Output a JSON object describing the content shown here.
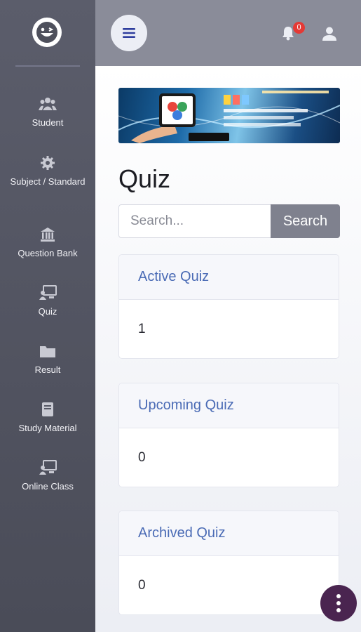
{
  "sidebar": {
    "logo_icon": "smiley-logo-icon",
    "items": [
      {
        "label": "Student",
        "icon": "users-icon"
      },
      {
        "label": "Subject / Standard",
        "icon": "gear-icon"
      },
      {
        "label": "Question Bank",
        "icon": "bank-icon"
      },
      {
        "label": "Quiz",
        "icon": "presentation-icon"
      },
      {
        "label": "Result",
        "icon": "folder-icon"
      },
      {
        "label": "Study Material",
        "icon": "book-icon"
      },
      {
        "label": "Online Class",
        "icon": "presentation-icon"
      }
    ]
  },
  "topbar": {
    "menu_icon": "hamburger-icon",
    "notification_icon": "bell-icon",
    "notification_count": "0",
    "user_icon": "user-icon"
  },
  "page": {
    "title": "Quiz",
    "search_placeholder": "Search...",
    "search_button": "Search"
  },
  "cards": [
    {
      "title": "Active Quiz",
      "value": "1"
    },
    {
      "title": "Upcoming Quiz",
      "value": "0"
    },
    {
      "title": "Archived Quiz",
      "value": "0"
    }
  ],
  "fab_icon": "more-vertical-icon",
  "colors": {
    "sidebar": "#52545f",
    "topbar": "#8a8c99",
    "accent_text": "#4a6bb5",
    "menu_icon": "#2f3e9e",
    "badge": "#e53935",
    "fab": "#4a2550"
  }
}
